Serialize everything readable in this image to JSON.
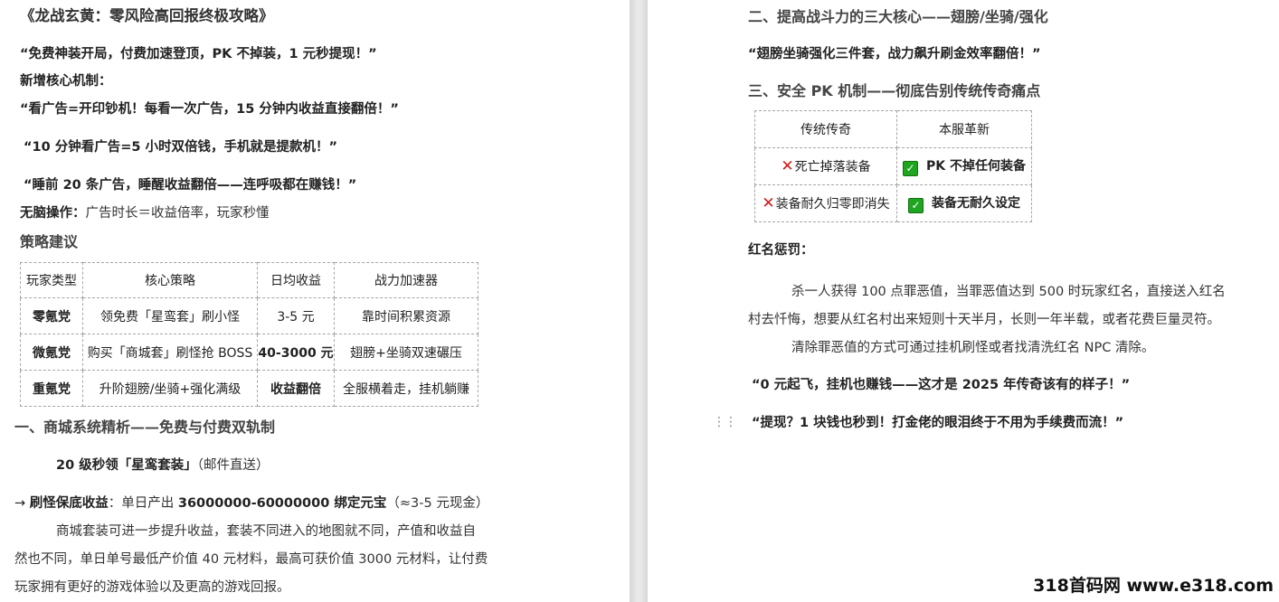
{
  "left": {
    "title": "《龙战玄黄：零风险高回报终极攻略》",
    "slogan": "“免费神装开局，付费加速登顶，PK 不掉装，1 元秒提现！”",
    "new_mech_label": "新增核心机制：",
    "ad1": "“看广告=开印钞机！每看一次广告，15 分钟内收益直接翻倍！”",
    "ad2": "“10 分钟看广告=5 小时双倍钱，手机就是提款机！”",
    "ad3": "“睡前 20 条广告，睡醒收益翻倍——连呼吸都在赚钱！”",
    "no_brain_label": "无脑操作：",
    "no_brain_text": "广告时长＝收益倍率，玩家秒懂",
    "strategy_heading": "策略建议",
    "strategy_table": {
      "headers": [
        "玩家类型",
        "核心策略",
        "日均收益",
        "战力加速器"
      ],
      "rows": [
        [
          "零氪党",
          "领免费「星鸾套」刷小怪",
          "3-5 元",
          "靠时间积累资源"
        ],
        [
          "微氪党",
          "购买「商城套」刷怪抢 BOSS",
          "40-3000 元",
          "翅膀+坐骑双速碾压"
        ],
        [
          "重氪党",
          "升阶翅膀/坐骑+强化满级",
          "收益翻倍",
          "全服横着走，挂机躺赚"
        ]
      ]
    },
    "section1": "一、商城系统精析——免费与付费双轨制",
    "lvl20": "20 级秒领「星鸾套装」",
    "lvl20_note": "（邮件直送）",
    "arrow": "→",
    "guarantee_label": "刷怪保底收益",
    "guarantee_text1": "：单日产出 ",
    "guarantee_bold": "36000000-60000000 绑定元宝",
    "guarantee_note": "（≈3-5 元现金）",
    "para1": "商城套装可进一步提升收益，套装不同进入的地图就不同，产值和收益自",
    "para2": "然也不同，单日单号最低产价值 40 元材料，最高可获价值 3000 元材料，让付费",
    "para3": "玩家拥有更好的游戏体验以及更高的游戏回报。"
  },
  "right": {
    "section2": "二、提高战斗力的三大核心——翅膀/坐骑/强化",
    "quote2": "“翅膀坐骑强化三件套，战力飙升刷金效率翻倍！”",
    "section3": "三、安全 PK 机制——彻底告别传统传奇痛点",
    "pk_table": {
      "headers": [
        "传统传奇",
        "本服革新"
      ],
      "rows": [
        [
          "死亡掉落装备",
          "PK 不掉任何装备"
        ],
        [
          "装备耐久归零即消失",
          "装备无耐久设定"
        ]
      ]
    },
    "red_label": "红名惩罚：",
    "red_p1": "杀一人获得 100 点罪恶值，当罪恶值达到 500 时玩家红名，直接送入红名",
    "red_p2": "村去忏悔，想要从红名村出来短则十天半月，长则一年半载，或者花费巨量灵符。",
    "red_p3": "清除罪恶值的方式可通过挂机刷怪或者找清洗红名 NPC 清除。",
    "quote3": "“0 元起飞，挂机也赚钱——这才是 2025 年传奇该有的样子！”",
    "quote4": "“提现？1 块钱也秒到！打金佬的眼泪终于不用为手续费而流！”"
  },
  "watermark": "318首码网 www.e318.com"
}
